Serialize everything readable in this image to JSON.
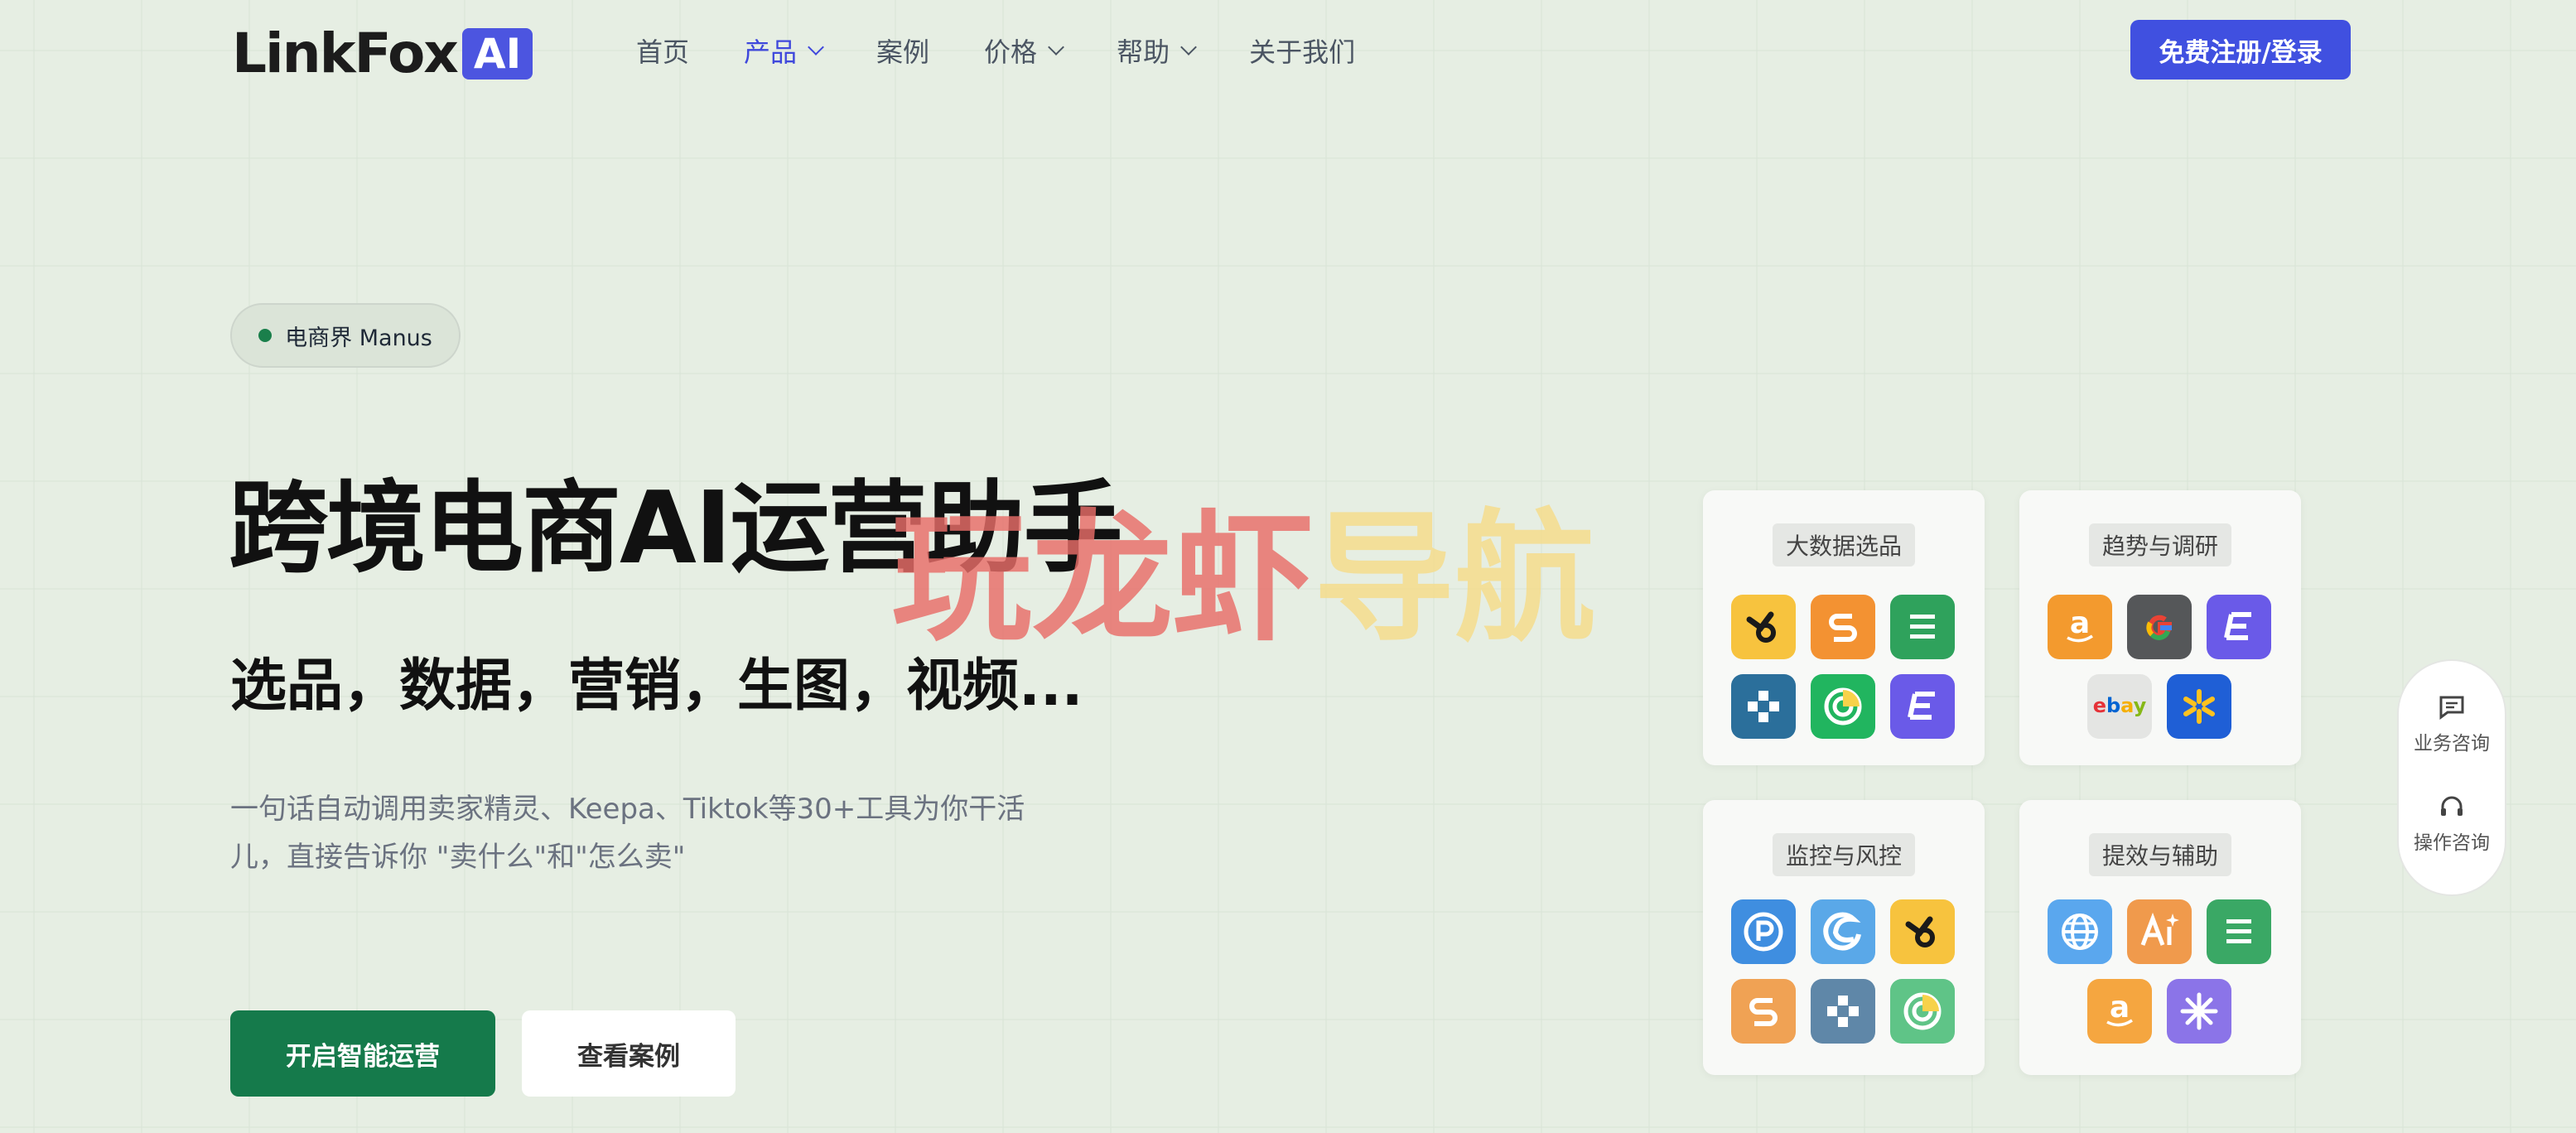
{
  "header": {
    "logo_text": "LinkFox",
    "logo_badge": "AI",
    "nav": [
      {
        "label": "首页",
        "dropdown": false,
        "active": false
      },
      {
        "label": "产品",
        "dropdown": true,
        "active": true
      },
      {
        "label": "案例",
        "dropdown": false,
        "active": false
      },
      {
        "label": "价格",
        "dropdown": true,
        "active": false
      },
      {
        "label": "帮助",
        "dropdown": true,
        "active": false
      },
      {
        "label": "关于我们",
        "dropdown": false,
        "active": false
      }
    ],
    "login_label": "免费注册/登录"
  },
  "hero": {
    "pill": "电商界 Manus",
    "title": "跨境电商AI运营助手",
    "subtitle": "选品，数据，营销，生图，视频...",
    "description": "一句话自动调用卖家精灵、Keepa、Tiktok等30+工具为你干活儿，直接告诉你 \"卖什么\"和\"怎么卖\"",
    "primary_button": "开启智能运营",
    "secondary_button": "查看案例"
  },
  "watermark": {
    "part1": "玩龙虾",
    "part2": "导航"
  },
  "cards": [
    {
      "label": "大数据选品",
      "icons": [
        "sellersprite-icon",
        "sif-icon",
        "list-icon",
        "grid-icon",
        "radar-icon",
        "elf-icon"
      ]
    },
    {
      "label": "趋势与调研",
      "icons": [
        "amazon-icon",
        "google-icon",
        "elf-icon",
        "ebay-icon",
        "walmart-icon"
      ]
    },
    {
      "label": "监控与风控",
      "icons": [
        "p-icon",
        "edge-icon",
        "sellersprite-icon",
        "sif-icon",
        "grid-icon",
        "radar-icon"
      ]
    },
    {
      "label": "提效与辅助",
      "icons": [
        "globe-icon",
        "ai-text-icon",
        "list-icon",
        "amazon-icon",
        "sparkle-icon"
      ]
    }
  ],
  "side_widget": {
    "business": "业务咨询",
    "operation": "操作咨询"
  },
  "colors": {
    "accent": "#4050e0",
    "primary_green": "#157a4b",
    "background": "#e6eee3"
  }
}
